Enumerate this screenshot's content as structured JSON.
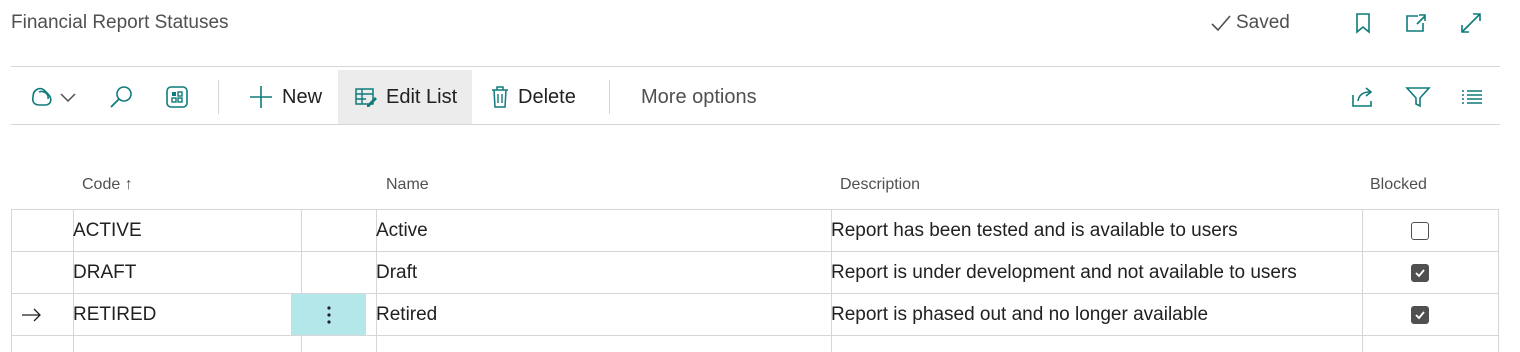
{
  "header": {
    "title": "Financial Report Statuses",
    "saved_label": "Saved"
  },
  "toolbar": {
    "new_label": "New",
    "edit_list_label": "Edit List",
    "delete_label": "Delete",
    "more_options_label": "More options"
  },
  "columns": {
    "code": "Code",
    "code_sort": "↑",
    "name": "Name",
    "description": "Description",
    "blocked": "Blocked"
  },
  "rows": [
    {
      "code": "ACTIVE",
      "name": "Active",
      "description": "Report has been tested and is available to users",
      "blocked": false,
      "current": false
    },
    {
      "code": "DRAFT",
      "name": "Draft",
      "description": "Report is under development and not available to users",
      "blocked": true,
      "current": false
    },
    {
      "code": "RETIRED",
      "name": "Retired",
      "description": "Report is phased out and no longer available",
      "blocked": true,
      "current": true
    }
  ],
  "colors": {
    "accent": "#0f7b7b",
    "selected_cell": "#b3e7ea"
  }
}
